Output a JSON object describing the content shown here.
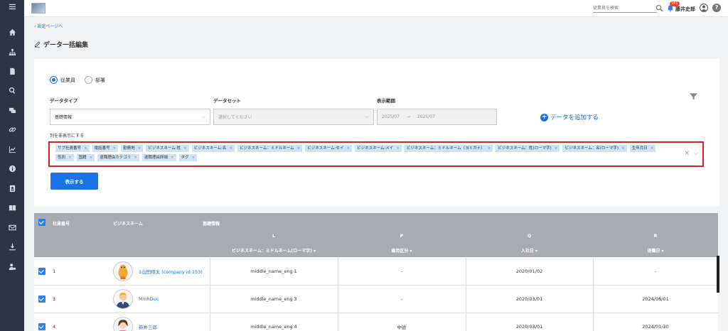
{
  "topbar": {
    "search_placeholder": "従業員を検索",
    "notification_count": "161",
    "user_name": "藤井史郎",
    "help": "?"
  },
  "nav": {
    "back_link": "設定ページへ",
    "page_title": "データ一括編集"
  },
  "filters": {
    "radio_employee": "従業員",
    "radio_department": "部署",
    "data_type_label": "データタイプ",
    "data_type_value": "基礎情報",
    "dataset_label": "データセット",
    "dataset_placeholder": "選択してください",
    "range_label": "表示範囲",
    "range_start": "2025/07",
    "range_end": "2025/07",
    "add_data": "データを追加する",
    "hide_columns_label": "列を非表示にする",
    "hidden_tags": [
      "サブ社員番号",
      "電話番号",
      "勤務地",
      "ビジネスネーム:姓",
      "ビジネスネーム:名",
      "ビジネスネーム：ミドルネーム",
      "ビジネスネーム:セイ",
      "ビジネスネーム:メイ",
      "ビジネスネーム：ミドルネーム（ヨミガナ）",
      "ビジネスネーム：姓(ローマ字)",
      "ビジネスネーム：名(ローマ字)",
      "生年月日",
      "性別",
      "国籍",
      "退職理由カテゴリ",
      "退職理由詳細",
      "タグ"
    ],
    "show_button": "表示する"
  },
  "table": {
    "col_employee_no": "社員番号",
    "col_business_name": "ビジネスネーム",
    "col_group": "基礎情報",
    "letters": [
      "L",
      "P",
      "Q",
      "R"
    ],
    "sub_headers": [
      "ビジネスネーム：ミドルネーム(ローマ字) ▾",
      "雇用区分 ▾",
      "入社日 ▾",
      "退職日 ▾"
    ],
    "rows": [
      {
        "no": "1",
        "name": "1山田翔太 (company id:153)",
        "middle": "middle_name_eng 1",
        "employment": "-",
        "joined": "2020/01/02",
        "retired": "-"
      },
      {
        "no": "3",
        "name": "MinhDuc",
        "middle": "middle_name_eng 3",
        "employment": "-",
        "joined": "2020/03/01",
        "retired": "2024/06/01"
      },
      {
        "no": "4",
        "name": "新井三郎",
        "middle": "middle_name_eng 4",
        "employment": "中途",
        "joined": "2020/03/01",
        "retired": "2024/01/30"
      }
    ]
  }
}
